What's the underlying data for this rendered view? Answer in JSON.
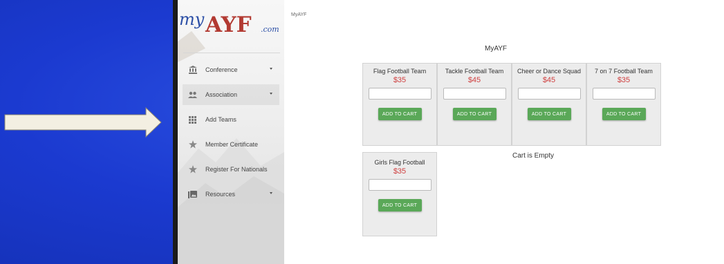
{
  "app": {
    "breadcrumb": "MyAYF",
    "page_title": "MyAYF"
  },
  "logo": {
    "text_my": "my",
    "text_ayf": "AYF",
    "text_com": ".com"
  },
  "sidebar": {
    "items": [
      {
        "label": "Conference",
        "icon": "institution-icon",
        "has_dropdown": true
      },
      {
        "label": "Association",
        "icon": "people-icon",
        "has_dropdown": true
      },
      {
        "label": "Add Teams",
        "icon": "grid-icon",
        "has_dropdown": false
      },
      {
        "label": "Member Certificate",
        "icon": "star-icon",
        "has_dropdown": false
      },
      {
        "label": "Register For Nationals",
        "icon": "star-icon",
        "has_dropdown": false
      },
      {
        "label": "Resources",
        "icon": "photo-library-icon",
        "has_dropdown": true
      }
    ]
  },
  "products": [
    {
      "name": "Flag Football Team",
      "price": "$35",
      "button": "ADD TO CART"
    },
    {
      "name": "Tackle Football Team",
      "price": "$45",
      "button": "ADD TO CART"
    },
    {
      "name": "Cheer or Dance Squad",
      "price": "$45",
      "button": "ADD TO CART"
    },
    {
      "name": "7 on 7 Football Team",
      "price": "$35",
      "button": "ADD TO CART"
    },
    {
      "name": "Girls Flag Football",
      "price": "$35",
      "button": "ADD TO CART"
    }
  ],
  "cart": {
    "status": "Cart is Empty"
  },
  "colors": {
    "backdrop": "#1b3ad0",
    "price": "#cf3f3f",
    "button": "#5aa858",
    "logo_red": "#b23a32",
    "logo_blue": "#2c4fa6"
  }
}
